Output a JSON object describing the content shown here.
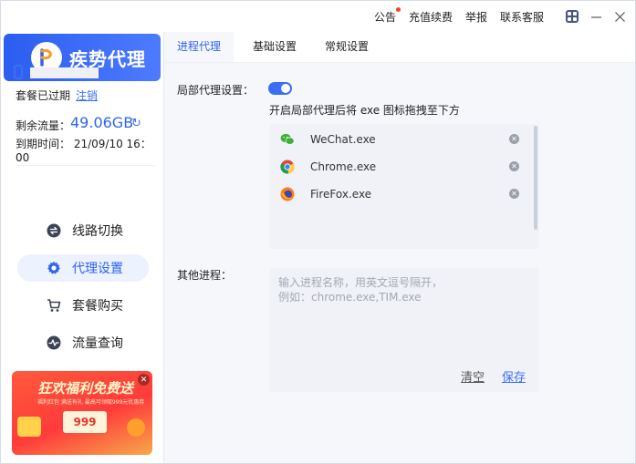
{
  "top": {
    "links": [
      "公告",
      "充值续费",
      "举报",
      "联系客服"
    ]
  },
  "brand": {
    "name": "疾势代理"
  },
  "account": {
    "status": "套餐已过期",
    "logout": "注销",
    "flow_label": "剩余流量：",
    "flow_value": "49.06GB",
    "expire_label": "到期时间：  21/09/10 16：00"
  },
  "nav": [
    {
      "label": "线路切换",
      "icon": "switch-icon"
    },
    {
      "label": "代理设置",
      "icon": "gear-icon"
    },
    {
      "label": "套餐购买",
      "icon": "cart-icon"
    },
    {
      "label": "流量查询",
      "icon": "pulse-icon"
    }
  ],
  "promo": {
    "title": "狂欢福利免费送",
    "subtitle": "福利红包 满送有礼 最高可领取999元优惠券",
    "coupon": "999"
  },
  "tabs": [
    "进程代理",
    "基础设置",
    "常规设置"
  ],
  "main": {
    "local_proxy_label": "局部代理设置：",
    "hint": "开启局部代理后将 exe 图标拖拽至下方",
    "processes": [
      {
        "name": "WeChat.exe",
        "icon": "wechat-icon"
      },
      {
        "name": "Chrome.exe",
        "icon": "chrome-icon"
      },
      {
        "name": "FireFox.exe",
        "icon": "firefox-icon"
      }
    ],
    "other_label": "其他进程：",
    "other_placeholder": "输入进程名称，用英文逗号隔开，\n例如：chrome.exe,TIM.exe",
    "clear": "清空",
    "save": "保存"
  },
  "colors": {
    "accent": "#3a6ff5",
    "brand_gradient_start": "#2b5df0",
    "promo_red": "#ff3b3b"
  }
}
